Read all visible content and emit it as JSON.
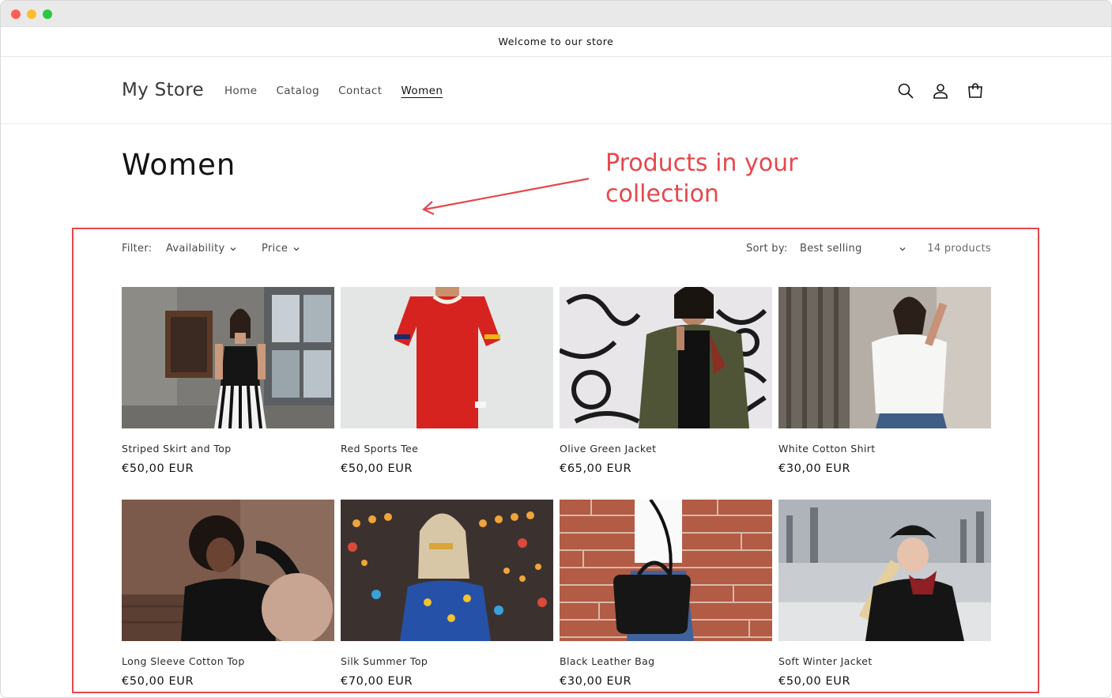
{
  "announcement": {
    "text": "Welcome to our store"
  },
  "header": {
    "logo": "My Store",
    "nav": [
      {
        "label": "Home",
        "active": false
      },
      {
        "label": "Catalog",
        "active": false
      },
      {
        "label": "Contact",
        "active": false
      },
      {
        "label": "Women",
        "active": true
      }
    ],
    "icons": [
      "search-icon",
      "account-icon",
      "cart-icon"
    ]
  },
  "page": {
    "title": "Women"
  },
  "annotation": {
    "text": "Products in your collection",
    "color": "#e5484d"
  },
  "toolbar": {
    "filter_label": "Filter:",
    "filters": [
      {
        "label": "Availability"
      },
      {
        "label": "Price"
      }
    ],
    "sort_label": "Sort by:",
    "sort_value": "Best selling",
    "count": "14 products"
  },
  "products": [
    {
      "title": "Striped Skirt and Top",
      "price": "€50,00 EUR"
    },
    {
      "title": "Red Sports Tee",
      "price": "€50,00 EUR"
    },
    {
      "title": "Olive Green Jacket",
      "price": "€65,00 EUR"
    },
    {
      "title": "White Cotton Shirt",
      "price": "€30,00 EUR"
    },
    {
      "title": "Long Sleeve Cotton Top",
      "price": "€50,00 EUR"
    },
    {
      "title": "Silk Summer Top",
      "price": "€70,00 EUR"
    },
    {
      "title": "Black Leather Bag",
      "price": "€30,00 EUR"
    },
    {
      "title": "Soft Winter Jacket",
      "price": "€50,00 EUR"
    }
  ]
}
